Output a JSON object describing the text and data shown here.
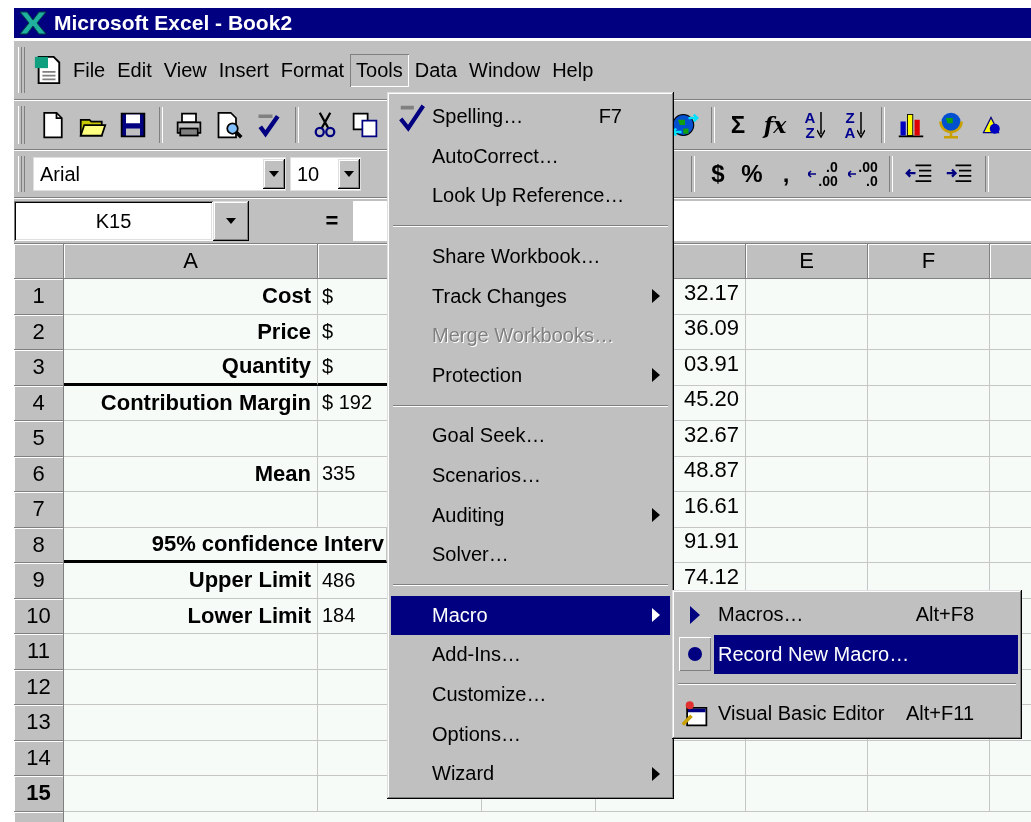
{
  "window": {
    "title": "Microsoft Excel - Book2"
  },
  "menu_bar": [
    {
      "label": "File",
      "selected": false
    },
    {
      "label": "Edit",
      "selected": false
    },
    {
      "label": "View",
      "selected": false
    },
    {
      "label": "Insert",
      "selected": false
    },
    {
      "label": "Format",
      "selected": false
    },
    {
      "label": "Tools",
      "selected": true
    },
    {
      "label": "Data",
      "selected": false
    },
    {
      "label": "Window",
      "selected": false
    },
    {
      "label": "Help",
      "selected": false
    }
  ],
  "standard_toolbar": {
    "left": [
      {
        "kind": "new"
      },
      {
        "kind": "open"
      },
      {
        "kind": "save"
      },
      {
        "kind": "separator"
      },
      {
        "kind": "print"
      },
      {
        "kind": "preview"
      },
      {
        "kind": "spelling"
      },
      {
        "kind": "separator"
      },
      {
        "kind": "cut"
      },
      {
        "kind": "copy"
      }
    ],
    "right": [
      {
        "kind": "web"
      },
      {
        "kind": "separator"
      },
      {
        "kind": "glyph",
        "label": "Σ"
      },
      {
        "kind": "function",
        "label": "fx"
      },
      {
        "kind": "sort",
        "top": "A",
        "bottom": "Z"
      },
      {
        "kind": "sort",
        "top": "Z",
        "bottom": "A"
      },
      {
        "kind": "separator"
      },
      {
        "kind": "chart"
      },
      {
        "kind": "map"
      },
      {
        "kind": "drawing"
      }
    ]
  },
  "format_toolbar": {
    "font": "Arial",
    "size": "10",
    "right": [
      {
        "kind": "separator"
      },
      {
        "kind": "glyph",
        "label": "$"
      },
      {
        "kind": "glyph",
        "label": "%"
      },
      {
        "kind": "glyph",
        "label": ","
      },
      {
        "kind": "decimal",
        "top": ".0",
        "bottom": ".00"
      },
      {
        "kind": "decimal",
        "top": ".00",
        "bottom": ".0"
      },
      {
        "kind": "separator"
      },
      {
        "kind": "outdent"
      },
      {
        "kind": "indent"
      },
      {
        "kind": "separator"
      }
    ]
  },
  "formula_bar": {
    "name_box": "K15",
    "equals": "="
  },
  "column_headers": [
    "A",
    "E",
    "F"
  ],
  "rows": [
    {
      "number": "1",
      "active": false,
      "rule_below": false,
      "a": "Cost",
      "b": "$",
      "d": "32.17"
    },
    {
      "number": "2",
      "active": false,
      "rule_below": false,
      "a": "Price",
      "b": "$",
      "d": "36.09"
    },
    {
      "number": "3",
      "active": false,
      "rule_below": true,
      "a": "Quantity",
      "b": "$",
      "d": "03.91"
    },
    {
      "number": "4",
      "active": false,
      "rule_below": false,
      "a": "Contribution Margin",
      "b": "$ 192",
      "d": "45.20"
    },
    {
      "number": "5",
      "active": false,
      "rule_below": false,
      "d": "32.67"
    },
    {
      "number": "6",
      "active": false,
      "rule_below": false,
      "a": "Mean",
      "b": "335",
      "d": "48.87"
    },
    {
      "number": "7",
      "active": false,
      "rule_below": false,
      "d": "16.61"
    },
    {
      "number": "8",
      "active": false,
      "rule_below": true,
      "a_span": "95% confidence Interv",
      "d": "91.91"
    },
    {
      "number": "9",
      "active": false,
      "rule_below": false,
      "a": "Upper Limit",
      "b": "486",
      "d": "74.12"
    },
    {
      "number": "10",
      "active": false,
      "rule_below": false,
      "a": "Lower Limit",
      "b": "184"
    },
    {
      "number": "11",
      "active": false,
      "rule_below": false
    },
    {
      "number": "12",
      "active": false,
      "rule_below": false
    },
    {
      "number": "13",
      "active": false,
      "rule_below": false
    },
    {
      "number": "14",
      "active": false,
      "rule_below": false
    },
    {
      "number": "15",
      "active": true,
      "rule_below": false
    }
  ],
  "tools_menu": [
    {
      "kind": "item",
      "label": "Spelling…",
      "shortcut": "F7",
      "disabled": false,
      "submenu": false,
      "selected": false
    },
    {
      "kind": "item",
      "label": "AutoCorrect…",
      "disabled": false,
      "submenu": false,
      "selected": false
    },
    {
      "kind": "item",
      "label": "Look Up Reference…",
      "disabled": false,
      "submenu": false,
      "selected": false
    },
    {
      "kind": "separator"
    },
    {
      "kind": "item",
      "label": "Share Workbook…",
      "disabled": false,
      "submenu": false,
      "selected": false
    },
    {
      "kind": "item",
      "label": "Track Changes",
      "disabled": false,
      "submenu": true,
      "selected": false
    },
    {
      "kind": "item",
      "label": "Merge Workbooks…",
      "disabled": true,
      "submenu": false,
      "selected": false
    },
    {
      "kind": "item",
      "label": "Protection",
      "disabled": false,
      "submenu": true,
      "selected": false
    },
    {
      "kind": "separator"
    },
    {
      "kind": "item",
      "label": "Goal Seek…",
      "disabled": false,
      "submenu": false,
      "selected": false
    },
    {
      "kind": "item",
      "label": "Scenarios…",
      "disabled": false,
      "submenu": false,
      "selected": false
    },
    {
      "kind": "item",
      "label": "Auditing",
      "disabled": false,
      "submenu": true,
      "selected": false
    },
    {
      "kind": "item",
      "label": "Solver…",
      "disabled": false,
      "submenu": false,
      "selected": false
    },
    {
      "kind": "separator"
    },
    {
      "kind": "item",
      "label": "Macro",
      "disabled": false,
      "submenu": true,
      "selected": true
    },
    {
      "kind": "item",
      "label": "Add-Ins…",
      "disabled": false,
      "submenu": false,
      "selected": false
    },
    {
      "kind": "item",
      "label": "Customize…",
      "disabled": false,
      "submenu": false,
      "selected": false
    },
    {
      "kind": "item",
      "label": "Options…",
      "disabled": false,
      "submenu": false,
      "selected": false
    },
    {
      "kind": "item",
      "label": "Wizard",
      "disabled": false,
      "submenu": true,
      "selected": false
    }
  ],
  "macro_submenu": [
    {
      "kind": "item",
      "label": "Macros…",
      "shortcut": "Alt+F8",
      "selected": false
    },
    {
      "kind": "item",
      "label": "Record New Macro…",
      "selected": true
    },
    {
      "kind": "separator"
    },
    {
      "kind": "item",
      "label": "Visual Basic Editor",
      "shortcut": "Alt+F11",
      "selected": false
    }
  ]
}
